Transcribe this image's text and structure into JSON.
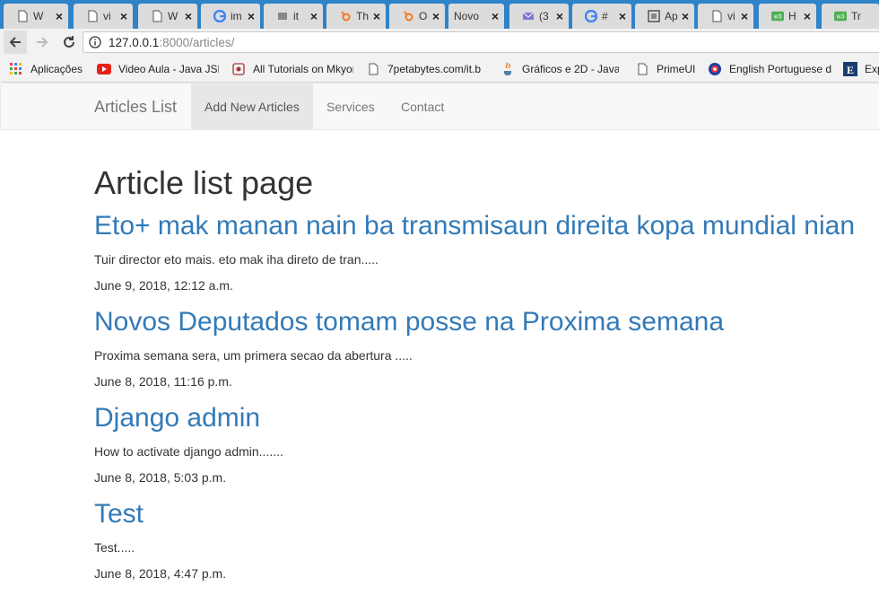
{
  "browser": {
    "tabs": [
      {
        "title": "W",
        "icon": "page-icon"
      },
      {
        "title": "vi",
        "icon": "page-icon"
      },
      {
        "title": "W",
        "icon": "page-icon"
      },
      {
        "title": "im",
        "icon": "google-icon"
      },
      {
        "title": "it",
        "icon": "stackoverflow-icon"
      },
      {
        "title": "Th",
        "icon": "hubspot-icon"
      },
      {
        "title": "O",
        "icon": "hubspot-icon"
      },
      {
        "title": "Novo",
        "icon": "none"
      },
      {
        "title": "(3",
        "icon": "mail-icon"
      },
      {
        "title": "#",
        "icon": "google-icon"
      },
      {
        "title": "Ap",
        "icon": "app-icon"
      },
      {
        "title": "vi",
        "icon": "page-icon"
      },
      {
        "title": "H",
        "icon": "w3-icon"
      },
      {
        "title": "Tr",
        "icon": "w3-icon"
      }
    ],
    "url_host": "127.0.0.1",
    "url_path": ":8000/articles/",
    "bookmarks": [
      {
        "label": "Aplicações",
        "icon": "apps-grid-icon"
      },
      {
        "label": "Video Aula - Java JSF",
        "icon": "youtube-icon"
      },
      {
        "label": "All Tutorials on Mkyong",
        "icon": "mkyong-icon"
      },
      {
        "label": "7petabytes.com/it.b",
        "icon": "page-icon"
      },
      {
        "label": "Gráficos e 2D - Java",
        "icon": "java-icon"
      },
      {
        "label": "PrimeUI",
        "icon": "page-icon"
      },
      {
        "label": "English Portuguese d",
        "icon": "dictionary-icon"
      },
      {
        "label": "Exp",
        "icon": "e-icon"
      }
    ]
  },
  "navbar": {
    "brand": "Articles List",
    "links": [
      "Add New Articles",
      "Services",
      "Contact"
    ]
  },
  "main": {
    "heading": "Article list page",
    "articles": [
      {
        "title": "Eto+ mak manan nain ba transmisaun direita kopa mundial nian",
        "summary": "Tuir director eto mais. eto mak iha direto de tran.....",
        "date": "June 9, 2018, 12:12 a.m."
      },
      {
        "title": "Novos Deputados tomam posse na Proxima semana",
        "summary": "Proxima semana sera, um primera secao da abertura .....",
        "date": "June 8, 2018, 11:16 p.m."
      },
      {
        "title": "Django admin",
        "summary": "How to activate django admin.......",
        "date": "June 8, 2018, 5:03 p.m."
      },
      {
        "title": "Test",
        "summary": "Test.....",
        "date": "June 8, 2018, 4:47 p.m."
      }
    ]
  },
  "colors": {
    "tabstrip": "#2f83c9",
    "link": "#337ab7",
    "navbar_bg": "#f8f8f8",
    "active_nav_bg": "#e7e7e7"
  }
}
